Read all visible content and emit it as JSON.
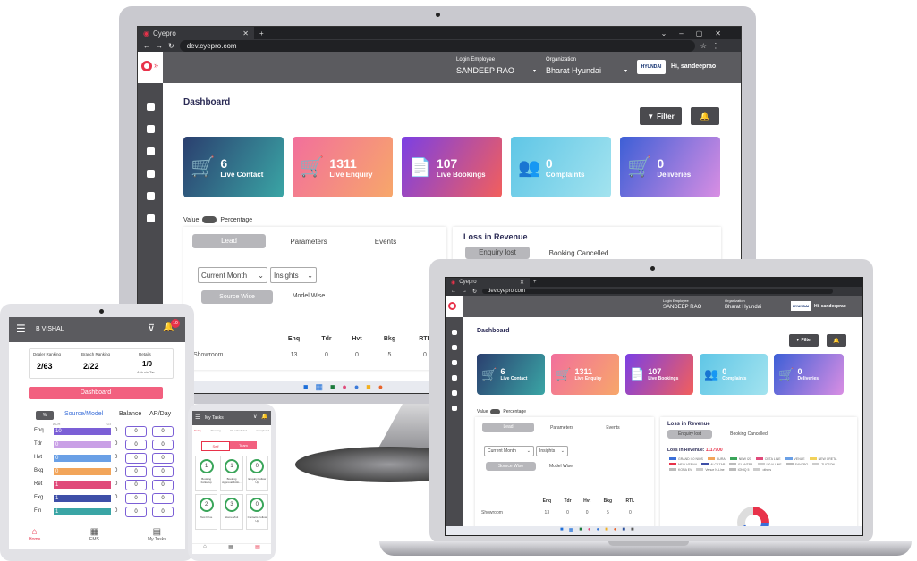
{
  "browser": {
    "tab_title": "Cyepro",
    "url": "dev.cyepro.com"
  },
  "header": {
    "login_label": "Login Employee",
    "login_value": "SANDEEP RAO",
    "org_label": "Organization",
    "org_value": "Bharat Hyundai",
    "brand": "HYUNDAI",
    "greeting": "Hi, sandeeprao"
  },
  "page_title": "Dashboard",
  "filter_label": "Filter",
  "cards": [
    {
      "value": "6",
      "label": "Live Contact"
    },
    {
      "value": "1311",
      "label": "Live Enquiry"
    },
    {
      "value": "107",
      "label": "Live Bookings"
    },
    {
      "value": "0",
      "label": "Complaints"
    },
    {
      "value": "0",
      "label": "Deliveries"
    }
  ],
  "toggle": {
    "left": "Value",
    "right": "Percentage"
  },
  "tabs": [
    "Lead",
    "Parameters",
    "Events"
  ],
  "selects": {
    "period": "Current Month",
    "mode": "Insights"
  },
  "subtabs": [
    "Source Wise",
    "Model Wise"
  ],
  "table": {
    "columns": [
      "Enq",
      "Tdr",
      "Hvt",
      "Bkg",
      "RTL"
    ],
    "row_label": "Showroom",
    "row_values": [
      "13",
      "0",
      "0",
      "5",
      "0"
    ]
  },
  "loss": {
    "title": "Loss in Revenue",
    "tabs": [
      "Enquiry lost",
      "Booking Cancelled"
    ],
    "revenue_label": "Loss in Revenue:",
    "revenue_value": "1117900",
    "legend": [
      "GRAND I10 NIOS",
      "AURA",
      "NEW I20",
      "CRTA LINE",
      "VENUE",
      "NEW CRETA",
      "NEW VERNA",
      "ALCAZAR",
      "ELANTRA",
      "I20 N LINE",
      "SANTRO",
      "TUCSON",
      "KONA EV",
      "Venue N-Line",
      "IONIQ 5",
      "others"
    ]
  },
  "tablet": {
    "user": "B VISHAL",
    "badge": "10",
    "stats": [
      {
        "label": "Dealer Ranking",
        "value": "2/63"
      },
      {
        "label": "Branch Ranking",
        "value": "2/22"
      },
      {
        "label": "Retails",
        "value": "1/0",
        "sub": "Ach v/s Tar"
      }
    ],
    "dashboard_btn": "Dashboard",
    "toggle_label": "%",
    "source_model": "Source/Model",
    "col_balance": "Balance",
    "col_arday": "AR/Day",
    "mini_headers": [
      "ACH",
      "TGT"
    ],
    "rows": [
      {
        "label": "Enq",
        "ach": "10",
        "tgt": "0",
        "bal": "0",
        "ar": "0",
        "color": "#7b5fd6"
      },
      {
        "label": "Tdr",
        "ach": "0",
        "tgt": "0",
        "bal": "0",
        "ar": "0",
        "color": "#c9a0e6"
      },
      {
        "label": "Hvt",
        "ach": "0",
        "tgt": "0",
        "bal": "0",
        "ar": "0",
        "color": "#6aa0e6"
      },
      {
        "label": "Bkg",
        "ach": "0",
        "tgt": "0",
        "bal": "0",
        "ar": "0",
        "color": "#f2a55a"
      },
      {
        "label": "Ret",
        "ach": "1",
        "tgt": "0",
        "bal": "0",
        "ar": "0",
        "color": "#e04a7a"
      },
      {
        "label": "Exg",
        "ach": "1",
        "tgt": "0",
        "bal": "0",
        "ar": "0",
        "color": "#3e4fa8"
      },
      {
        "label": "Fin",
        "ach": "1",
        "tgt": "0",
        "bal": "0",
        "ar": "0",
        "color": "#3aa5a5"
      }
    ],
    "nav": [
      "Home",
      "EMS",
      "My Tasks"
    ]
  },
  "phone": {
    "title": "My Tasks",
    "tabs": [
      "Today",
      "Pending",
      "Re-scheduled",
      "Completed"
    ],
    "subtabs": [
      "Self",
      "Team"
    ],
    "tasks": [
      {
        "n": "1",
        "label": "Booking Followup"
      },
      {
        "n": "1",
        "label": "Booking Approval Follo..."
      },
      {
        "n": "0",
        "label": "Enquiry Follow Up"
      },
      {
        "n": "2",
        "label": "Test Drive"
      },
      {
        "n": "3",
        "label": "Home Visit"
      },
      {
        "n": "0",
        "label": "Contacts Follow Up"
      }
    ]
  },
  "colors": {
    "accent": "#f2607f",
    "brand_red": "#e8324a",
    "header_bg": "#5b5b5f"
  }
}
